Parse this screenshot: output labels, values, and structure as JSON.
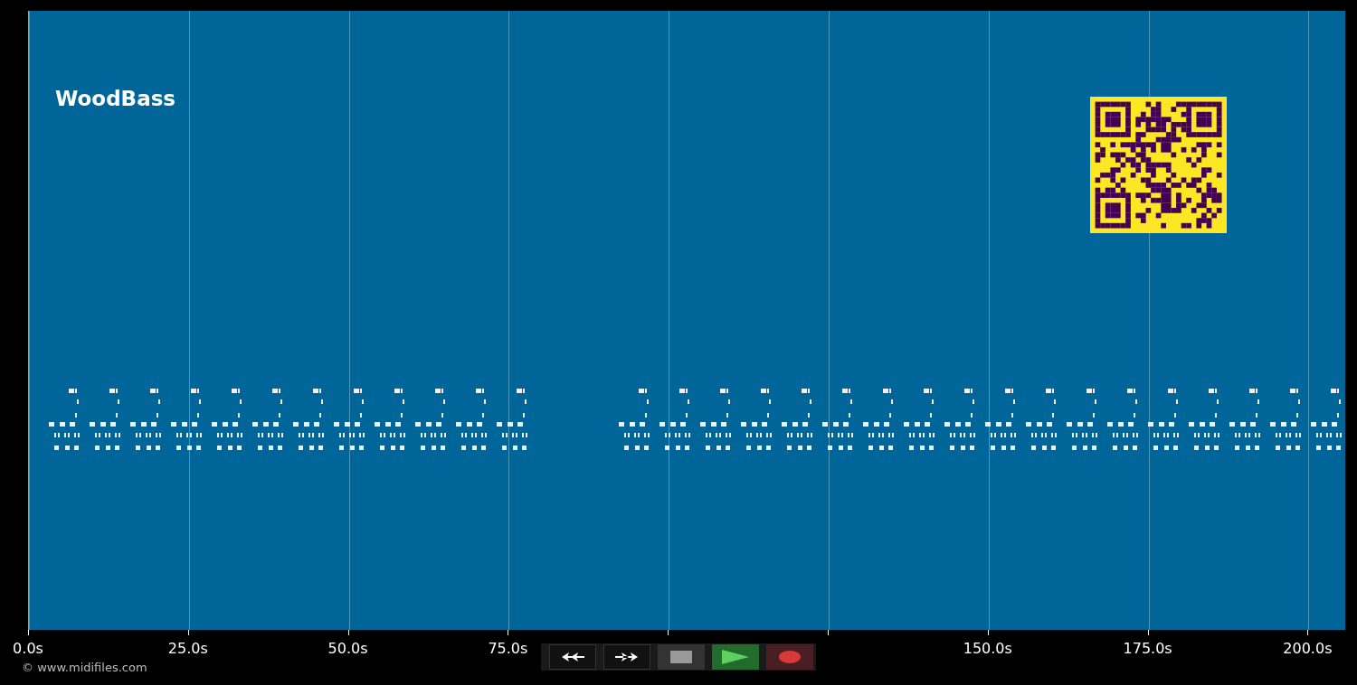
{
  "title": "WoodBass",
  "axis_labels": [
    "0.0s",
    "25.0s",
    "50.0s",
    "75.0s",
    "150.0s",
    "175.0s",
    "200.0s"
  ],
  "copyright": "© www.midifiles.com",
  "controls": [
    {
      "kind": "rewind"
    },
    {
      "kind": "forward"
    },
    {
      "kind": "stop"
    },
    {
      "kind": "play"
    },
    {
      "kind": "record"
    }
  ]
}
